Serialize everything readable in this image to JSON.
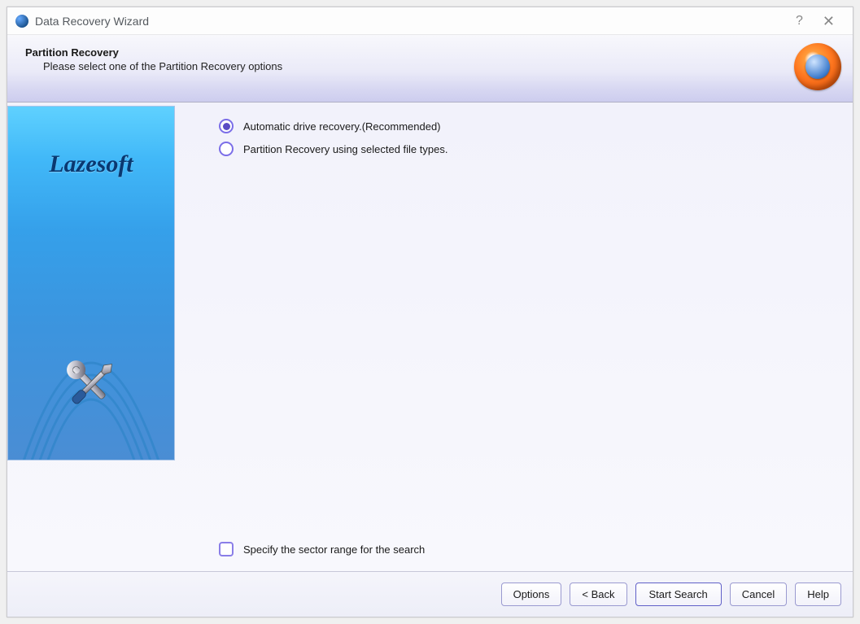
{
  "window": {
    "title": "Data Recovery Wizard"
  },
  "header": {
    "title": "Partition Recovery",
    "subtitle": "Please select one of the Partition Recovery options"
  },
  "sidebar": {
    "brand": "Lazesoft"
  },
  "options": {
    "radios": [
      {
        "label": "Automatic drive recovery.(Recommended)",
        "selected": true
      },
      {
        "label": "Partition Recovery using selected file types.",
        "selected": false
      }
    ],
    "checkbox": {
      "label": "Specify the sector range for the search",
      "checked": false
    }
  },
  "buttons": {
    "options": "Options",
    "back": "< Back",
    "start": "Start Search",
    "cancel": "Cancel",
    "help": "Help"
  }
}
